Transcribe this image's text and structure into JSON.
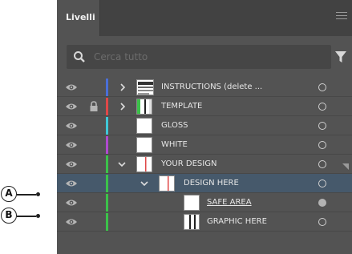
{
  "panel": {
    "tab_label": "Livelli",
    "search_placeholder": "Cerca tutto"
  },
  "layers": [
    {
      "name": "INSTRUCTIONS (delete ...",
      "color": "#4a6fd8",
      "expanded": false,
      "locked": false,
      "thumb": "instructions-thumbnail"
    },
    {
      "name": "TEMPLATE",
      "color": "#e04848",
      "expanded": false,
      "locked": true,
      "thumb": "template-thumbnail"
    },
    {
      "name": "GLOSS",
      "color": "#3fc8d8",
      "expanded": false,
      "locked": false,
      "thumb": "blank-thumbnail"
    },
    {
      "name": "WHITE",
      "color": "#b04ad0",
      "expanded": false,
      "locked": false,
      "thumb": "blank-thumbnail"
    },
    {
      "name": "YOUR DESIGN",
      "color": "#3cc24a",
      "expanded": true,
      "locked": false,
      "thumb": "design-thumbnail"
    },
    {
      "name": "DESIGN HERE",
      "color": "#3cc24a",
      "expanded": true,
      "locked": false,
      "selected": true,
      "thumb": "design-thumbnail"
    },
    {
      "name": "SAFE AREA",
      "color": "#3cc24a",
      "underline": true,
      "target_filled": true,
      "thumb": "blank-thumbnail"
    },
    {
      "name": "GRAPHIC HERE",
      "color": "#3cc24a",
      "thumb": "graphic-thumbnail"
    }
  ],
  "callouts": [
    {
      "label": "A"
    },
    {
      "label": "B"
    }
  ],
  "colors": {
    "panel_bg": "#535353",
    "header_bg": "#424242",
    "selected_row": "#46596b",
    "text": "#e6e6e6"
  }
}
